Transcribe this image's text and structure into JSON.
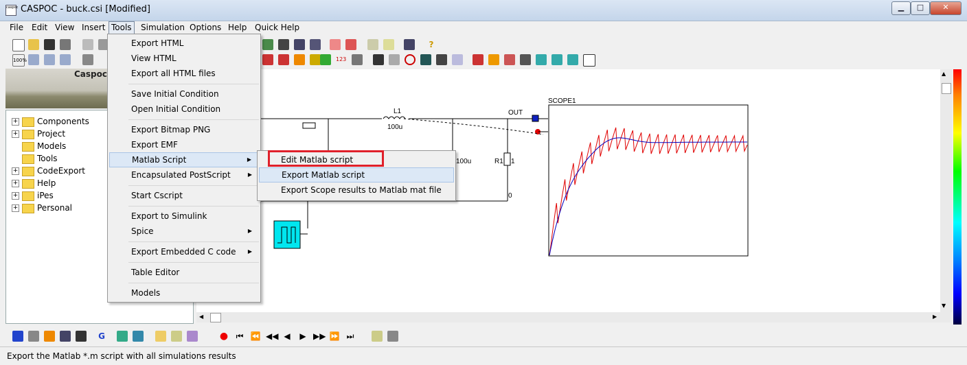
{
  "window": {
    "title": "CASPOC - buck.csi [Modified]",
    "app_icon_text": "caspoc"
  },
  "menubar": [
    "File",
    "Edit",
    "View",
    "Insert",
    "Tools",
    "Simulation",
    "Options",
    "Help",
    "Quick Help"
  ],
  "banner": {
    "text": "Caspoc"
  },
  "tree": [
    {
      "label": "Components",
      "expandable": true
    },
    {
      "label": "Project",
      "expandable": true
    },
    {
      "label": "Models",
      "expandable": false
    },
    {
      "label": "Tools",
      "expandable": false
    },
    {
      "label": "CodeExport",
      "expandable": true
    },
    {
      "label": "Help",
      "expandable": true
    },
    {
      "label": "iPes",
      "expandable": true
    },
    {
      "label": "Personal",
      "expandable": true
    }
  ],
  "tools_menu": [
    {
      "label": "Export HTML"
    },
    {
      "label": "View HTML"
    },
    {
      "label": "Export all HTML files"
    },
    {
      "label": "Save Initial Condition"
    },
    {
      "label": "Open Initial Condition"
    },
    {
      "label": "Export Bitmap PNG"
    },
    {
      "label": "Export EMF"
    },
    {
      "label": "Matlab Script",
      "submenu": true
    },
    {
      "label": "Encapsulated PostScript",
      "submenu": true
    },
    {
      "label": "Start Cscript"
    },
    {
      "label": "Export to Simulink"
    },
    {
      "label": "Spice",
      "submenu": true
    },
    {
      "label": "Export Embedded C code",
      "submenu": true
    },
    {
      "label": "Table Editor"
    },
    {
      "label": "Models"
    }
  ],
  "matlab_submenu": [
    {
      "label": "Edit Matlab script"
    },
    {
      "label": "Export Matlab script"
    },
    {
      "label": "Export Scope results to Matlab mat file"
    }
  ],
  "circuit": {
    "inductor_label": "L1",
    "inductor_value": "100u",
    "capacitor_value": "100u",
    "resistor_label": "R1",
    "resistor_value": "1",
    "out_label": "OUT",
    "ground_label": "0",
    "scope_label": "SCOPE1"
  },
  "colors": {
    "red_trace": "#e00000",
    "blue_trace": "#0000c0",
    "highlight_box": "#e0202a"
  },
  "status": {
    "text": "Export the Matlab *.m script with all simulations results"
  }
}
